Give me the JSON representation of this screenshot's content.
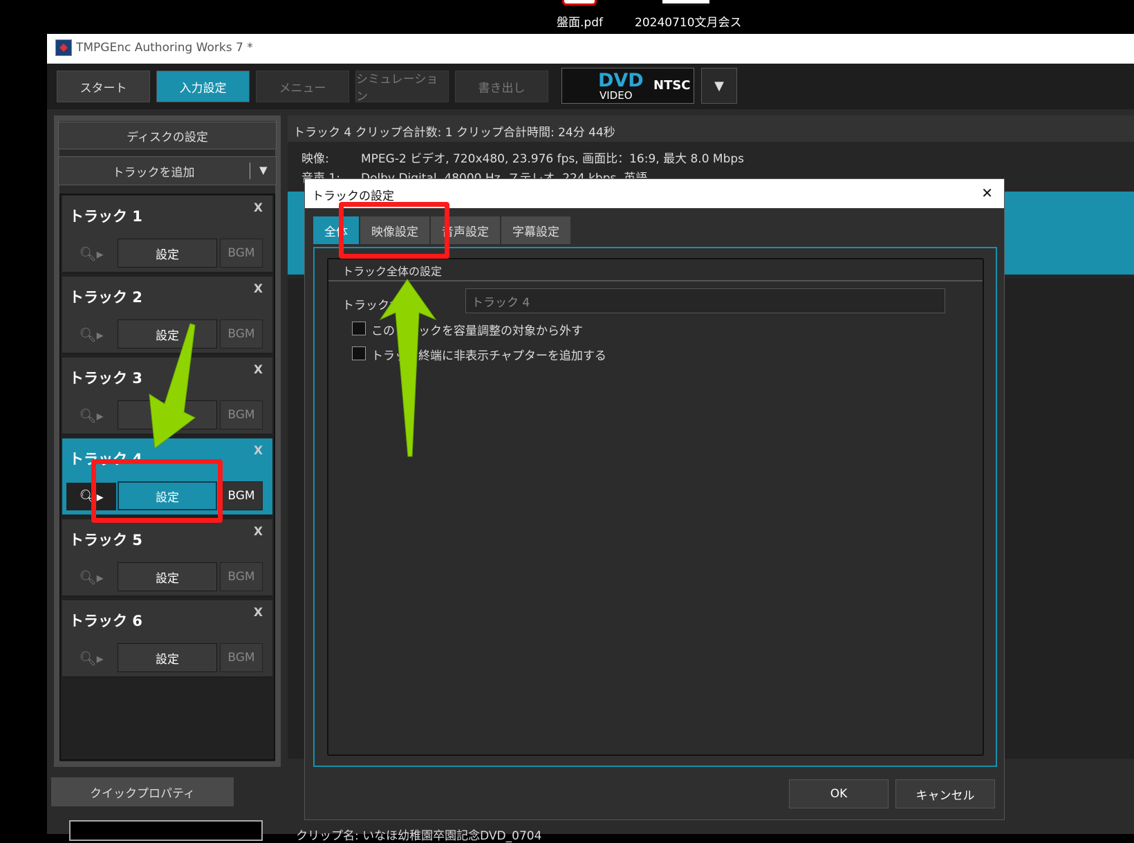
{
  "desktop": {
    "file1": "盤面.pdf",
    "file2": "20240710文月会ス"
  },
  "window": {
    "title": "TMPGEnc Authoring Works 7 *"
  },
  "toolbar": {
    "start": "スタート",
    "input": "入力設定",
    "menu": "メニュー",
    "simulation": "シミュレーション",
    "export": "書き出し",
    "disc_type": "DVD",
    "disc_sub": "VIDEO",
    "standard": "NTSC"
  },
  "left": {
    "disc_settings": "ディスクの設定",
    "add_track": "トラックを追加",
    "tracks": [
      {
        "title": "トラック 1",
        "set": "設定",
        "bgm": "BGM"
      },
      {
        "title": "トラック 2",
        "set": "設定",
        "bgm": "BGM"
      },
      {
        "title": "トラック 3",
        "set": "",
        "bgm": "BGM"
      },
      {
        "title": "トラック 4",
        "set": "設定",
        "bgm": "BGM"
      },
      {
        "title": "トラック 5",
        "set": "設定",
        "bgm": "BGM"
      },
      {
        "title": "トラック 6",
        "set": "設定",
        "bgm": "BGM"
      }
    ],
    "close_label": "X"
  },
  "info": {
    "header": "トラック 4  クリップ合計数:  1    クリップ合計時間:  24分 44秒",
    "video_label": "映像:",
    "video_value": "MPEG-2 ビデオ,  720x480,  23.976 fps,  画面比：16:9,  最大 8.0 Mbps",
    "audio_label": "音声 1:",
    "audio_value": "Dolby Digital,  48000 Hz,  ステレオ,  224 kbps,  英語"
  },
  "dialog": {
    "title": "トラックの設定",
    "close": "✕",
    "tabs": [
      "全体",
      "映像設定",
      "音声設定",
      "字幕設定"
    ],
    "group_title": "トラック全体の設定",
    "name_label": "トラック名(",
    "name_value": "トラック 4",
    "check1": "このトラックを容量調整の対象から外す",
    "check2": "トラック終端に非表示チャプターを追加する",
    "ok": "OK",
    "cancel": "キャンセル"
  },
  "bottom": {
    "quick_props": "クイックプロパティ",
    "clip_name": "クリップ名:  いなほ幼稚園卒園記念DVD_0704"
  },
  "colors": {
    "accent": "#1a90ad",
    "highlight": "#ff1a1a",
    "arrow": "#8fd400"
  }
}
